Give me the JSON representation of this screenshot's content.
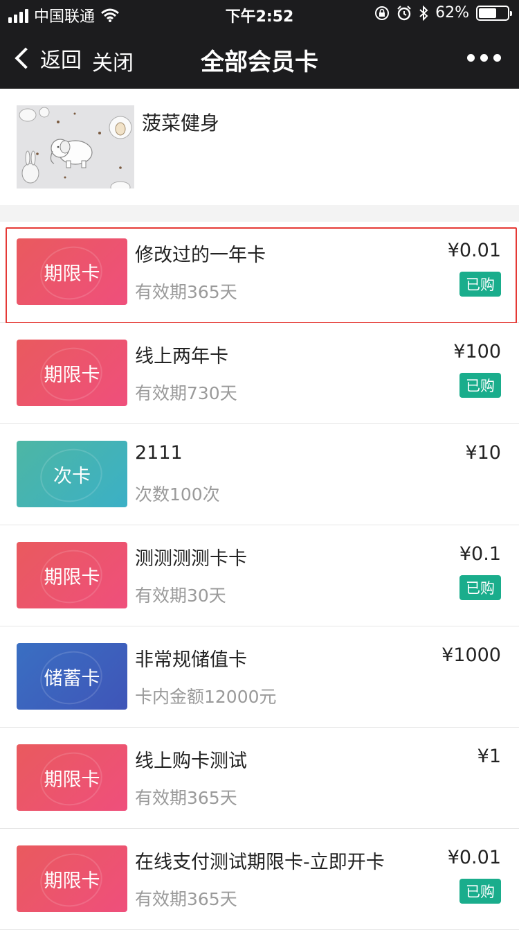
{
  "status_bar": {
    "carrier": "中国联通",
    "time": "下午2:52",
    "battery_percent": "62%",
    "battery_level": 0.62
  },
  "nav": {
    "back_label": "返回",
    "close_label": "关闭",
    "title": "全部会员卡"
  },
  "store": {
    "name": "菠菜健身"
  },
  "cards": [
    {
      "badge": "期限卡",
      "type": "limit",
      "title": "修改过的一年卡",
      "subtitle": "有效期365天",
      "price": "¥0.01",
      "status": "已购",
      "selected": true
    },
    {
      "badge": "期限卡",
      "type": "limit",
      "title": "线上两年卡",
      "subtitle": "有效期730天",
      "price": "¥100",
      "status": "已购",
      "selected": false
    },
    {
      "badge": "次卡",
      "type": "times",
      "title": "2111",
      "subtitle": "次数100次",
      "price": "¥10",
      "status": "",
      "selected": false
    },
    {
      "badge": "期限卡",
      "type": "limit",
      "title": "测测测测卡卡",
      "subtitle": "有效期30天",
      "price": "¥0.1",
      "status": "已购",
      "selected": false
    },
    {
      "badge": "储蓄卡",
      "type": "stored",
      "title": "非常规储值卡",
      "subtitle": "卡内金额12000元",
      "price": "¥1000",
      "status": "",
      "selected": false
    },
    {
      "badge": "期限卡",
      "type": "limit",
      "title": "线上购卡测试",
      "subtitle": "有效期365天",
      "price": "¥1",
      "status": "",
      "selected": false
    },
    {
      "badge": "期限卡",
      "type": "limit",
      "title": "在线支付测试期限卡-立即开卡",
      "subtitle": "有效期365天",
      "price": "¥0.01",
      "status": "已购",
      "selected": false
    }
  ],
  "colors": {
    "nav_bg": "#1c1c1e",
    "limit_badge": "#ea5568",
    "times_badge": "#45b3b3",
    "stored_badge": "#3c62be",
    "bought_tag": "#1aad8c",
    "selection_outline": "#e53935"
  },
  "icons": {
    "signal": "signal-bars-icon",
    "wifi": "wifi-icon",
    "lock": "rotation-lock-icon",
    "alarm": "alarm-icon",
    "bluetooth": "bluetooth-icon",
    "battery": "battery-icon",
    "back": "chevron-left-icon",
    "more": "more-dots-icon"
  }
}
